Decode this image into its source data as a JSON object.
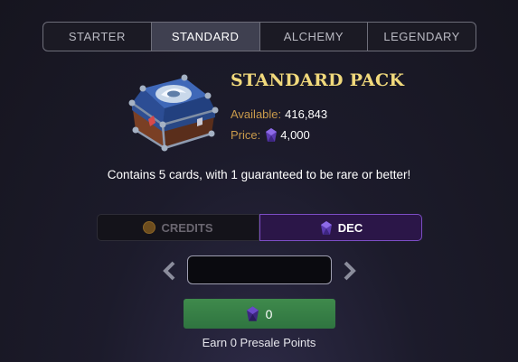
{
  "tabs": [
    {
      "label": "STARTER",
      "active": false
    },
    {
      "label": "STANDARD",
      "active": true
    },
    {
      "label": "ALCHEMY",
      "active": false
    },
    {
      "label": "LEGENDARY",
      "active": false
    }
  ],
  "pack": {
    "title": "STANDARD PACK",
    "available_label": "Available:",
    "available_value": "416,843",
    "price_label": "Price:",
    "price_value": "4,000",
    "description": "Contains 5 cards, with 1 guaranteed to be rare or better!"
  },
  "currency": {
    "credits_label": "CREDITS",
    "dec_label": "DEC",
    "selected": "DEC"
  },
  "quantity": {
    "value": "",
    "placeholder": ""
  },
  "buy": {
    "amount": "0"
  },
  "earn_text": "Earn 0 Presale Points",
  "colors": {
    "gold": "#f1d97c",
    "label_orange": "#c99a4b",
    "dec_purple": "#7c4dc4",
    "buy_green": "#3f8a4c"
  },
  "icons": {
    "chest": "pack-chest-icon",
    "dec": "dec-gem-icon",
    "credits": "credits-coin-icon",
    "prev": "chevron-left-icon",
    "next": "chevron-right-icon"
  }
}
